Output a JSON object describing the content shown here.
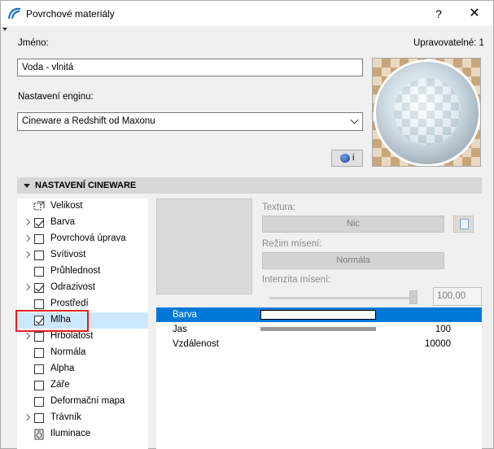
{
  "window": {
    "title": "Povrchové materiály",
    "help_label": "?",
    "close_label": "✕"
  },
  "form": {
    "name_label": "Jméno:",
    "editable_label": "Upravovatelné: 1",
    "name_value": "Voda - vlnitá",
    "engine_label": "Nastavení enginu:",
    "engine_value": "Cineware a Redshift od Maxonu",
    "info_label": "i"
  },
  "section": {
    "title": "NASTAVENÍ CINEWARE"
  },
  "tree": [
    {
      "label": "Velikost",
      "type": "icon",
      "icon": "size-icon",
      "checked": false,
      "expandable": false
    },
    {
      "label": "Barva",
      "type": "checkbox",
      "checked": true,
      "expandable": true
    },
    {
      "label": "Povrchová úprava",
      "type": "checkbox",
      "checked": false,
      "expandable": true
    },
    {
      "label": "Svítivost",
      "type": "checkbox",
      "checked": false,
      "expandable": true
    },
    {
      "label": "Průhlednost",
      "type": "checkbox",
      "checked": false,
      "expandable": false
    },
    {
      "label": "Odrazivost",
      "type": "checkbox",
      "checked": true,
      "expandable": true
    },
    {
      "label": "Prostředí",
      "type": "checkbox",
      "checked": false,
      "expandable": false
    },
    {
      "label": "Mlha",
      "type": "checkbox",
      "checked": true,
      "expandable": false,
      "selected": true
    },
    {
      "label": "Hrbolatost",
      "type": "checkbox",
      "checked": false,
      "expandable": true
    },
    {
      "label": "Normála",
      "type": "checkbox",
      "checked": false,
      "expandable": false
    },
    {
      "label": "Alpha",
      "type": "checkbox",
      "checked": false,
      "expandable": false
    },
    {
      "label": "Záře",
      "type": "checkbox",
      "checked": false,
      "expandable": false
    },
    {
      "label": "Deformační mapa",
      "type": "checkbox",
      "checked": false,
      "expandable": false
    },
    {
      "label": "Trávník",
      "type": "checkbox",
      "checked": false,
      "expandable": true
    },
    {
      "label": "Iluminace",
      "type": "icon",
      "icon": "illumination-icon",
      "checked": false,
      "expandable": false
    }
  ],
  "texture": {
    "texture_label": "Textura:",
    "texture_value": "Nic",
    "blend_label": "Režim mísení:",
    "blend_value": "Normála",
    "intensity_label": "Intenzita mísení:",
    "intensity_value": "100,00"
  },
  "params": [
    {
      "name": "Barva",
      "value": "",
      "kind": "color",
      "color": "#ffffff"
    },
    {
      "name": "Jas",
      "value": "100",
      "kind": "bar"
    },
    {
      "name": "Vzdálenost",
      "value": "10000",
      "kind": "text"
    }
  ],
  "colors": {
    "selection_blue": "#0078d7",
    "tree_selected": "#cce8ff",
    "highlight_red": "#e02020"
  }
}
